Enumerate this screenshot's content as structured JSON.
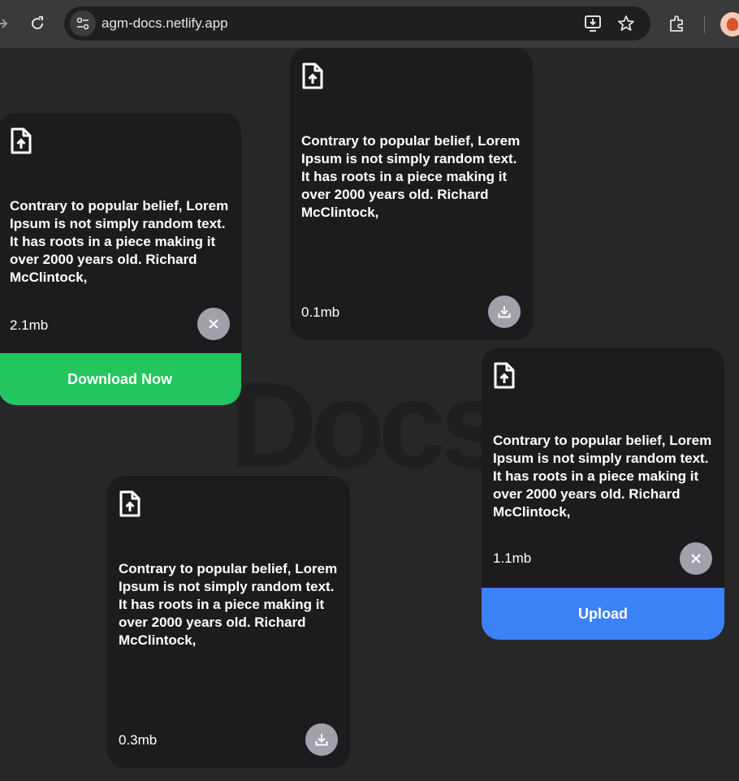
{
  "browser": {
    "url": "agm-docs.netlify.app"
  },
  "background_text": "Docs",
  "cards": [
    {
      "description": "Contrary to popular belief, Lorem Ipsum is not simply random text. It has roots in a piece making it over 2000 years old. Richard McClintock,",
      "size": "2.1mb",
      "action_icon": "close-icon",
      "tag": {
        "label": "Download Now",
        "color": "#22c55e"
      }
    },
    {
      "description": "Contrary to popular belief, Lorem Ipsum is not simply random text. It has roots in a piece making it over 2000 years old. Richard McClintock,",
      "size": "0.1mb",
      "action_icon": "download-icon"
    },
    {
      "description": "Contrary to popular belief, Lorem Ipsum is not simply random text. It has roots in a piece making it over 2000 years old. Richard McClintock,",
      "size": "1.1mb",
      "action_icon": "close-icon",
      "tag": {
        "label": "Upload",
        "color": "#3b82f6"
      }
    },
    {
      "description": "Contrary to popular belief, Lorem Ipsum is not simply random text. It has roots in a piece making it over 2000 years old. Richard McClintock,",
      "size": "0.3mb",
      "action_icon": "download-icon"
    }
  ],
  "colors": {
    "page_bg": "#27272a",
    "card_bg": "#1c1c1f",
    "circle_button": "#a1a1aa"
  }
}
